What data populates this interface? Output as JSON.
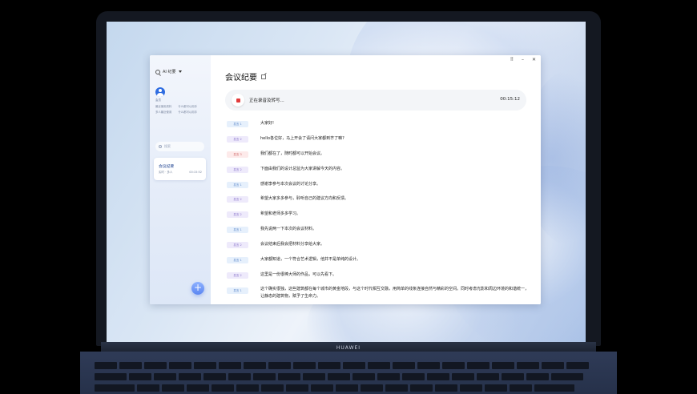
{
  "device": {
    "brand": "HUAWEI"
  },
  "sidebar": {
    "app_label": "AI 纪要",
    "user_name": "会员",
    "info_rows": [
      [
        "最近使用资料",
        "什么都可以用手"
      ],
      [
        "多人最近使用",
        "什么都可以用手"
      ]
    ],
    "search_placeholder": "搜索",
    "active_item": {
      "title": "会议纪要",
      "subtitle": "实时 · 多人",
      "time": "00:15:52"
    },
    "add_button_label": "+"
  },
  "window": {
    "controls": [
      "⠿",
      "–",
      "✕"
    ],
    "title": "会议纪要"
  },
  "recording": {
    "status": "正在录音及转写...",
    "time": "00:15:12"
  },
  "transcript": [
    {
      "speaker": "发言 1",
      "color": "blue",
      "text": "大家好!"
    },
    {
      "speaker": "发言 2",
      "color": "purple",
      "text": "hello各位好，马上开会了请问大家都到齐了嘛?"
    },
    {
      "speaker": "发言 3",
      "color": "pink",
      "text": "我们都在了，随时都可以开始会议。"
    },
    {
      "speaker": "发言 2",
      "color": "purple",
      "text": "下面由我们的设计总监为大家讲解今天的内容。"
    },
    {
      "speaker": "发言 1",
      "color": "blue",
      "text": "感谢李参与本次会议的讨论分享。"
    },
    {
      "speaker": "发言 2",
      "color": "purple",
      "text": "希望大家多多参与，聆听自己的建议方向和反馈。"
    },
    {
      "speaker": "发言 2",
      "color": "purple",
      "text": "希望和老师多多学习。"
    },
    {
      "speaker": "发言 1",
      "color": "blue",
      "text": "我先说两一下本次的会议材料。"
    },
    {
      "speaker": "发言 2",
      "color": "purple",
      "text": "会议结束后我会把材料分享给大家。"
    },
    {
      "speaker": "发言 1",
      "color": "blue",
      "text": "大家都知道，一个符合艺术逻辑，他并不是单纯的设计。"
    },
    {
      "speaker": "发言 2",
      "color": "purple",
      "text": "这里是一份很棒大师的作品，可以先看下。"
    },
    {
      "speaker": "发言 1",
      "color": "blue",
      "text": "这个确实很独，这些建筑都在每个城市的黄金地段，与这个时代相互交融，用简单的线条连接自然与精彩的空间。同时考虑光影和周边环境的和谐统一，让静态的建筑物，赋予了生命力。"
    }
  ]
}
